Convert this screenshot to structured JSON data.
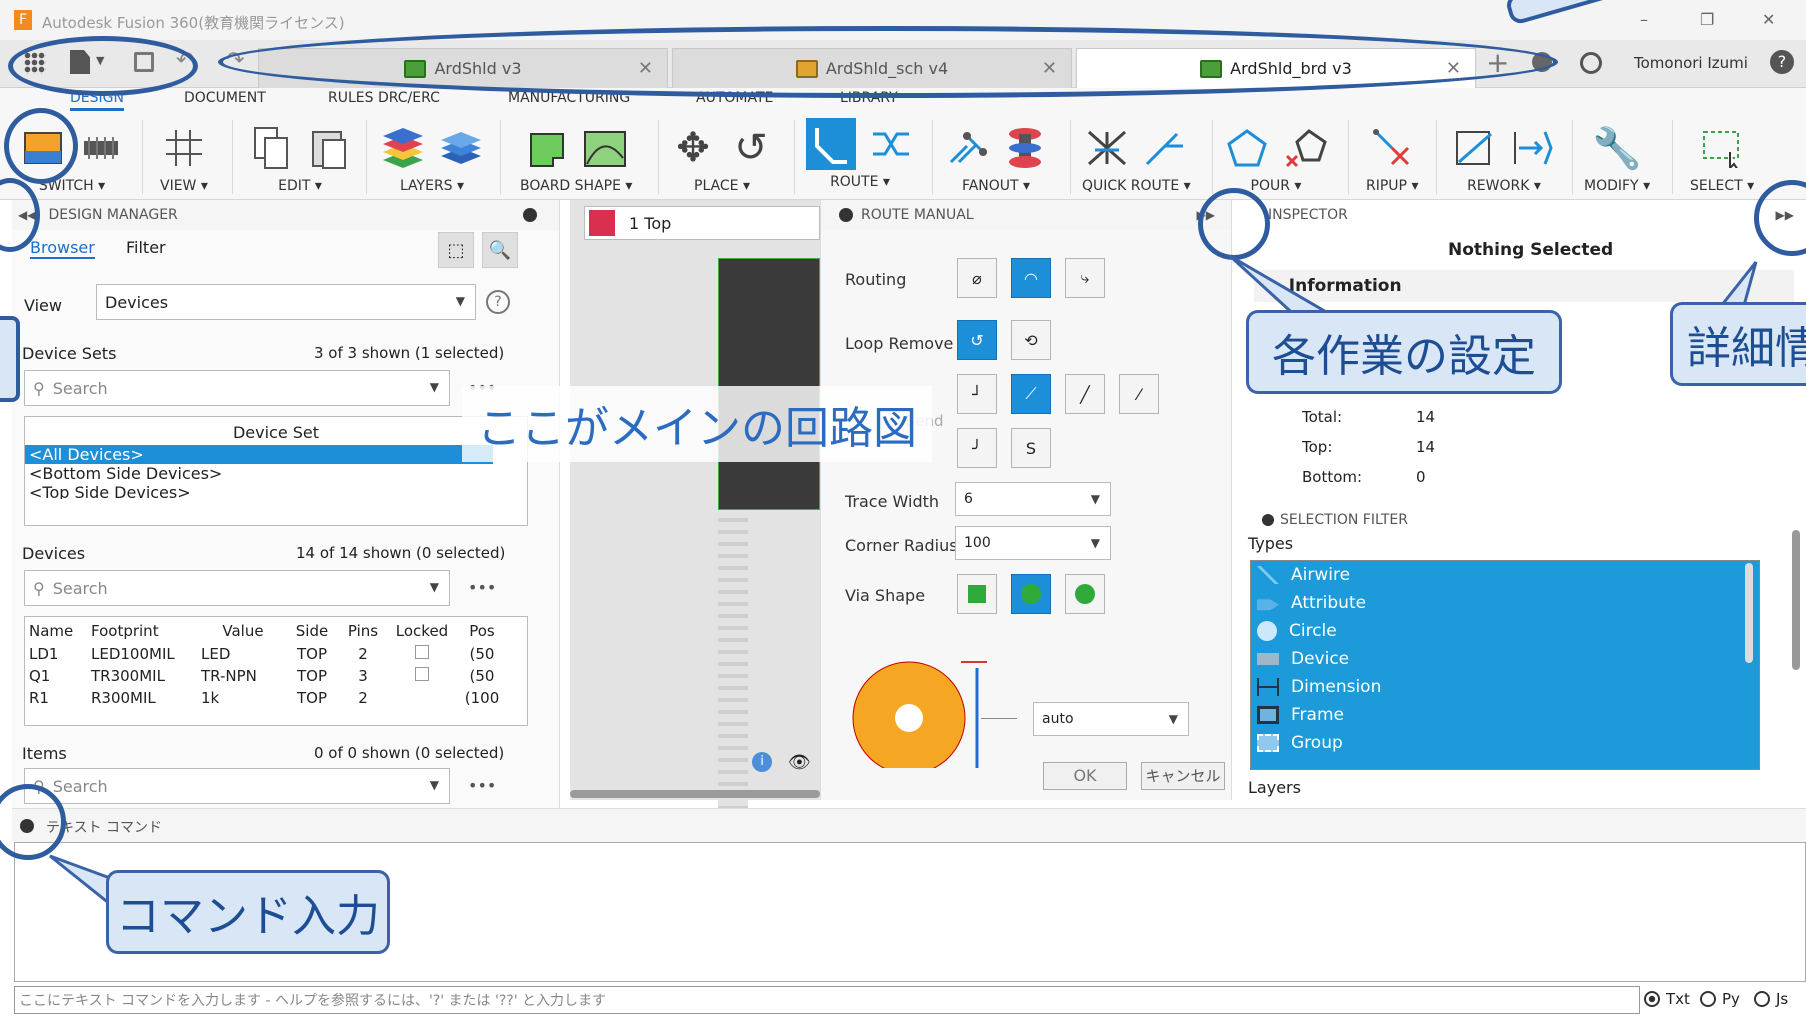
{
  "window": {
    "title": "Autodesk Fusion 360(教育機関ライセンス)",
    "user": "Tomonori Izumi",
    "controls": [
      "–",
      "❐",
      "✕"
    ]
  },
  "tabs": [
    {
      "label": "ArdShld v3"
    },
    {
      "label": "ArdShld_sch v4"
    },
    {
      "label": "ArdShld_brd v3"
    }
  ],
  "ribbon_tabs": [
    "DESIGN",
    "DOCUMENT",
    "RULES DRC/ERC",
    "MANUFACTURING",
    "AUTOMATE",
    "LIBRARY"
  ],
  "ribbon_groups": [
    "SWITCH ▾",
    "VIEW ▾",
    "EDIT ▾",
    "LAYERS ▾",
    "BOARD SHAPE ▾",
    "PLACE ▾",
    "ROUTE ▾",
    "FANOUT ▾",
    "QUICK ROUTE ▾",
    "POUR ▾",
    "RIPUP ▾",
    "REWORK ▾",
    "MODIFY ▾",
    "SELECT ▾"
  ],
  "design_manager": {
    "title": "DESIGN MANAGER",
    "tabs": [
      "Browser",
      "Filter"
    ],
    "view_label": "View",
    "view_value": "Devices",
    "device_sets_label": "Device Sets",
    "device_sets_count": "3 of 3 shown (1 selected)",
    "search_placeholder": "Search",
    "more": "•••",
    "device_set_header": "Device Set",
    "device_sets": [
      "<All Devices>",
      "<Bottom Side Devices>",
      "<Top Side Devices>"
    ],
    "devices_label": "Devices",
    "devices_count": "14 of 14 shown (0 selected)",
    "device_columns": [
      "Name",
      "Footprint",
      "Value",
      "Side",
      "Pins",
      "Locked",
      "Pos"
    ],
    "device_rows": [
      [
        "LD1",
        "LED100MIL",
        "LED",
        "TOP",
        "2",
        "",
        "(50"
      ],
      [
        "Q1",
        "TR300MIL",
        "TR-NPN",
        "TOP",
        "3",
        "",
        "(50"
      ],
      [
        "R1",
        "R300MIL",
        "1k",
        "TOP",
        "2",
        "",
        "(100"
      ]
    ],
    "items_label": "Items",
    "items_count": "0 of 0 shown (0 selected)"
  },
  "canvas": {
    "layer": "1 Top"
  },
  "route_manual": {
    "title": "ROUTE MANUAL",
    "routing": "Routing",
    "loop_remove": "Loop Remove",
    "bend": "Bend",
    "trace_width_label": "Trace Width",
    "trace_width": "6",
    "corner_radius_label": "Corner Radius",
    "corner_radius": "100",
    "via_shape_label": "Via Shape",
    "via_size": "auto",
    "ok": "OK",
    "cancel": "キャンセル"
  },
  "inspector": {
    "title": "INSPECTOR",
    "nothing": "Nothing Selected",
    "info": "Information",
    "total_label": "Total:",
    "total": "14",
    "top_label": "Top:",
    "top": "14",
    "bottom_label": "Bottom:",
    "bottom": "0",
    "selection_filter": "SELECTION FILTER",
    "types_label": "Types",
    "types": [
      "Airwire",
      "Attribute",
      "Circle",
      "Device",
      "Dimension",
      "Frame",
      "Group"
    ],
    "layers_label": "Layers"
  },
  "command": {
    "title": "テキスト コマンド",
    "placeholder": "ここにテキスト コマンドを入力します - ヘルプを参照するには、'?' または '??' と入力します",
    "modes": [
      "Txt",
      "Py",
      "Js"
    ]
  },
  "annotations": {
    "main": "ここがメインの回路図",
    "settings": "各作業の設定",
    "details": "詳細情",
    "command": "コマンド入力"
  }
}
